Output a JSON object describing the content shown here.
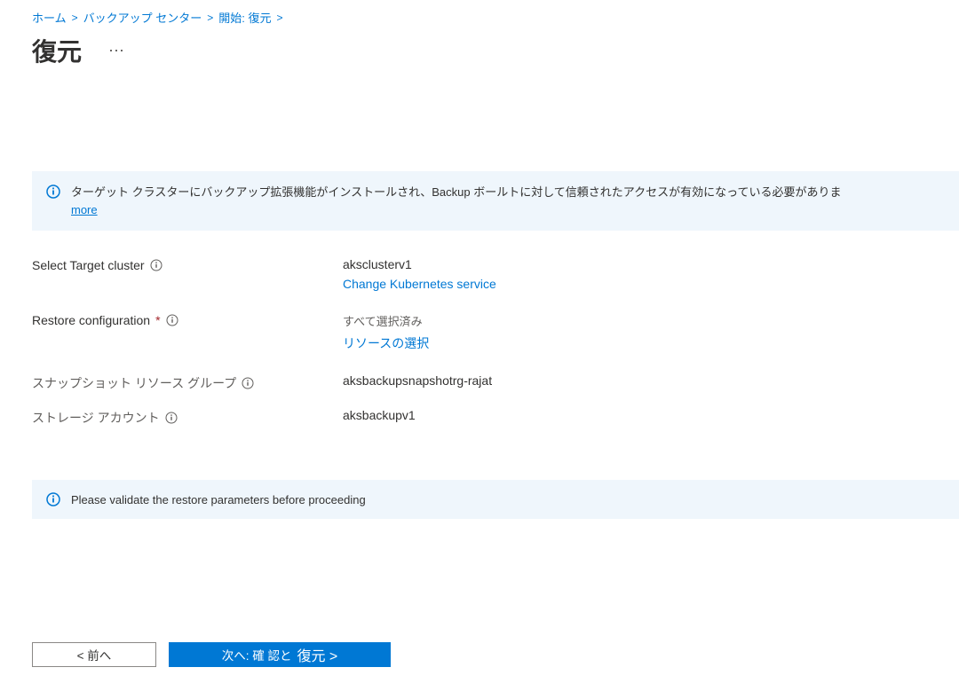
{
  "breadcrumb": {
    "home": "ホーム",
    "backup_center": "バックアップ センター",
    "start_restore": "開始: 復元"
  },
  "title": "復元",
  "more_menu_icon": "more-icon",
  "notice": {
    "icon": "info-icon",
    "text": "ターゲット クラスターにバックアップ拡張機能がインストールされ、Backup ボールトに対して信頼されたアクセスが有効になっている必要がありま",
    "more_link": "more"
  },
  "fields": {
    "target_cluster": {
      "label": "Select Target cluster",
      "value": "aksclusterv1",
      "change_link": "Change Kubernetes service"
    },
    "restore_config": {
      "label": "Restore configuration",
      "value_text": "すべて選択済み",
      "select_link": "リソースの選択"
    },
    "snapshot_rg": {
      "label": "スナップショット リソース グループ",
      "value": "aksbackupsnapshotrg-rajat"
    },
    "storage_account": {
      "label": "ストレージ アカウント",
      "value": "aksbackupv1"
    }
  },
  "validate_notice": {
    "icon": "info-icon",
    "text": "Please validate the restore parameters before proceeding"
  },
  "footer": {
    "prev": "< 前へ",
    "next_prefix": "次へ: 確 認と",
    "next_main": "復元 >"
  }
}
